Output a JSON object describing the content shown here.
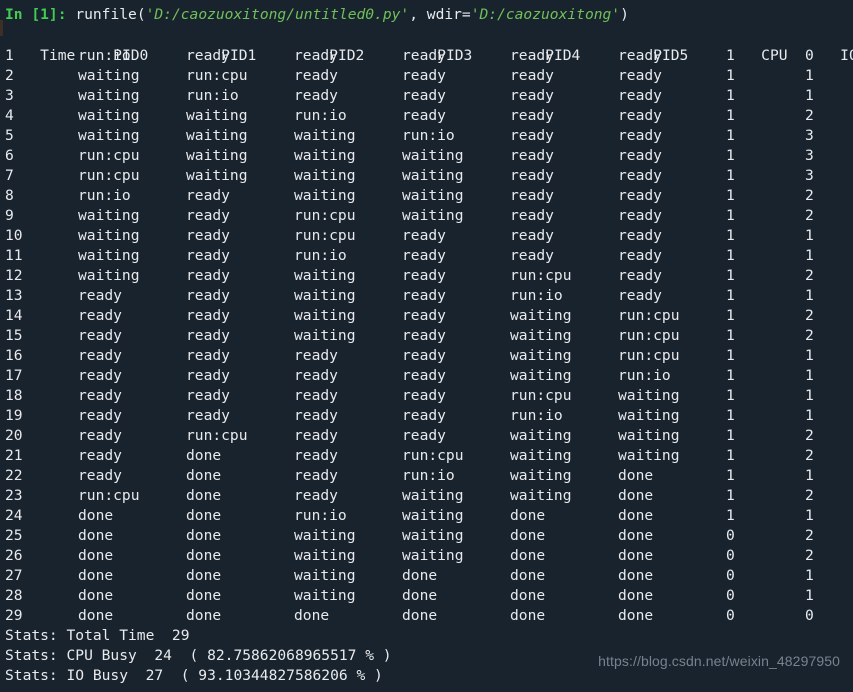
{
  "console": {
    "prompt_label": "In [1]:",
    "command": {
      "func": "runfile(",
      "arg1_string": "'D:/caozuoxitong/untitled0.py'",
      "separator": ", ",
      "kwarg_name": "wdir=",
      "arg2_string": "'D:/caozuoxitong'",
      "close_paren": ")"
    }
  },
  "table": {
    "headers": [
      "Time",
      "PID0",
      "PID1",
      "PID2",
      "PID3",
      "PID4",
      "PID5",
      "CPU",
      "IOs"
    ],
    "rows": [
      [
        "1",
        "run:io",
        "ready",
        "ready",
        "ready",
        "ready",
        "ready",
        "1",
        "0"
      ],
      [
        "2",
        "waiting",
        "run:cpu",
        "ready",
        "ready",
        "ready",
        "ready",
        "1",
        "1"
      ],
      [
        "3",
        "waiting",
        "run:io",
        "ready",
        "ready",
        "ready",
        "ready",
        "1",
        "1"
      ],
      [
        "4",
        "waiting",
        "waiting",
        "run:io",
        "ready",
        "ready",
        "ready",
        "1",
        "2"
      ],
      [
        "5",
        "waiting",
        "waiting",
        "waiting",
        "run:io",
        "ready",
        "ready",
        "1",
        "3"
      ],
      [
        "6",
        "run:cpu",
        "waiting",
        "waiting",
        "waiting",
        "ready",
        "ready",
        "1",
        "3"
      ],
      [
        "7",
        "run:cpu",
        "waiting",
        "waiting",
        "waiting",
        "ready",
        "ready",
        "1",
        "3"
      ],
      [
        "8",
        "run:io",
        "ready",
        "waiting",
        "waiting",
        "ready",
        "ready",
        "1",
        "2"
      ],
      [
        "9",
        "waiting",
        "ready",
        "run:cpu",
        "waiting",
        "ready",
        "ready",
        "1",
        "2"
      ],
      [
        "10",
        "waiting",
        "ready",
        "run:cpu",
        "ready",
        "ready",
        "ready",
        "1",
        "1"
      ],
      [
        "11",
        "waiting",
        "ready",
        "run:io",
        "ready",
        "ready",
        "ready",
        "1",
        "1"
      ],
      [
        "12",
        "waiting",
        "ready",
        "waiting",
        "ready",
        "run:cpu",
        "ready",
        "1",
        "2"
      ],
      [
        "13",
        "ready",
        "ready",
        "waiting",
        "ready",
        "run:io",
        "ready",
        "1",
        "1"
      ],
      [
        "14",
        "ready",
        "ready",
        "waiting",
        "ready",
        "waiting",
        "run:cpu",
        "1",
        "2"
      ],
      [
        "15",
        "ready",
        "ready",
        "waiting",
        "ready",
        "waiting",
        "run:cpu",
        "1",
        "2"
      ],
      [
        "16",
        "ready",
        "ready",
        "ready",
        "ready",
        "waiting",
        "run:cpu",
        "1",
        "1"
      ],
      [
        "17",
        "ready",
        "ready",
        "ready",
        "ready",
        "waiting",
        "run:io",
        "1",
        "1"
      ],
      [
        "18",
        "ready",
        "ready",
        "ready",
        "ready",
        "run:cpu",
        "waiting",
        "1",
        "1"
      ],
      [
        "19",
        "ready",
        "ready",
        "ready",
        "ready",
        "run:io",
        "waiting",
        "1",
        "1"
      ],
      [
        "20",
        "ready",
        "run:cpu",
        "ready",
        "ready",
        "waiting",
        "waiting",
        "1",
        "2"
      ],
      [
        "21",
        "ready",
        "done",
        "ready",
        "run:cpu",
        "waiting",
        "waiting",
        "1",
        "2"
      ],
      [
        "22",
        "ready",
        "done",
        "ready",
        "run:io",
        "waiting",
        "done",
        "1",
        "1"
      ],
      [
        "23",
        "run:cpu",
        "done",
        "ready",
        "waiting",
        "waiting",
        "done",
        "1",
        "2"
      ],
      [
        "24",
        "done",
        "done",
        "run:io",
        "waiting",
        "done",
        "done",
        "1",
        "1"
      ],
      [
        "25",
        "done",
        "done",
        "waiting",
        "waiting",
        "done",
        "done",
        "0",
        "2"
      ],
      [
        "26",
        "done",
        "done",
        "waiting",
        "waiting",
        "done",
        "done",
        "0",
        "2"
      ],
      [
        "27",
        "done",
        "done",
        "waiting",
        "done",
        "done",
        "done",
        "0",
        "1"
      ],
      [
        "28",
        "done",
        "done",
        "waiting",
        "done",
        "done",
        "done",
        "0",
        "1"
      ],
      [
        "29",
        "done",
        "done",
        "done",
        "done",
        "done",
        "done",
        "0",
        "0"
      ]
    ]
  },
  "stats": [
    "Stats: Total Time  29",
    "Stats: CPU Busy  24  ( 82.75862068965517 % )",
    "Stats: IO Busy  27  ( 93.10344827586206 % )"
  ],
  "watermark": "https://blog.csdn.net/weixin_48297950",
  "colors": {
    "background": "#19232d",
    "text": "#e8eaed",
    "prompt": "#41cd52",
    "string": "#70c05a",
    "watermark": "#7d8896"
  }
}
